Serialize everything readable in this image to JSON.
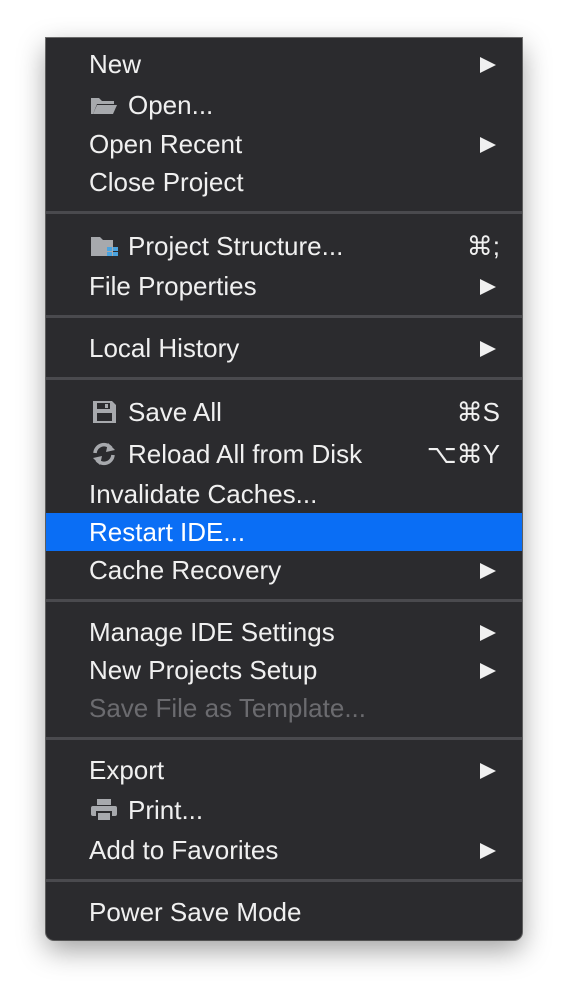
{
  "menu": {
    "items": [
      {
        "label": "New"
      },
      {
        "label": "Open...",
        "icon": "folder-open-icon"
      },
      {
        "label": "Open Recent"
      },
      {
        "label": "Close Project"
      },
      {
        "label": "Project Structure...",
        "icon": "project-structure-icon",
        "shortcut": "⌘;"
      },
      {
        "label": "File Properties"
      },
      {
        "label": "Local History"
      },
      {
        "label": "Save All",
        "icon": "floppy-disk-icon",
        "shortcut": "⌘S"
      },
      {
        "label": "Reload All from Disk",
        "icon": "reload-icon",
        "shortcut": "⌥⌘Y"
      },
      {
        "label": "Invalidate Caches..."
      },
      {
        "label": "Restart IDE...",
        "highlighted": true
      },
      {
        "label": "Cache Recovery"
      },
      {
        "label": "Manage IDE Settings"
      },
      {
        "label": "New Projects Setup"
      },
      {
        "label": "Save File as Template...",
        "disabled": true
      },
      {
        "label": "Export"
      },
      {
        "label": "Print...",
        "icon": "printer-icon"
      },
      {
        "label": "Add to Favorites"
      },
      {
        "label": "Power Save Mode"
      }
    ]
  },
  "colors": {
    "menu_background": "#2b2b2e",
    "highlight": "#0a6ef5",
    "text": "#f0f0f0",
    "disabled_text": "#6b6b6f",
    "separator": "#4a4a4e"
  }
}
